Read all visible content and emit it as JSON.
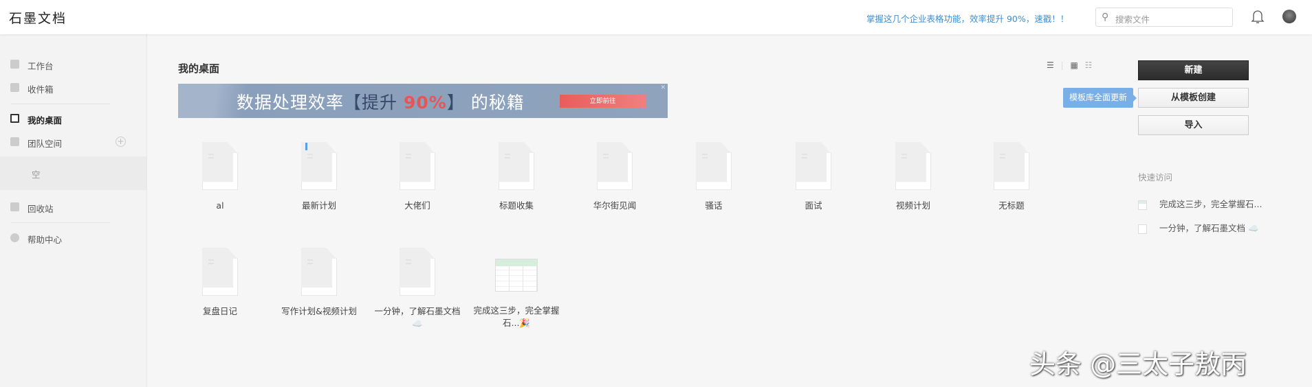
{
  "header": {
    "logo": "石墨文档",
    "tagline": "掌握这几个企业表格功能，效率提升 90%，速戳！！",
    "search_placeholder": "搜索文件"
  },
  "sidebar": {
    "items": [
      {
        "label": "工作台"
      },
      {
        "label": "收件箱"
      },
      {
        "label": "我的桌面"
      },
      {
        "label": "团队空间"
      },
      {
        "label": "回收站"
      },
      {
        "label": "帮助中心"
      }
    ],
    "team_empty": "空"
  },
  "main": {
    "title": "我的桌面",
    "banner": {
      "text_a": "数据处理效率",
      "text_b": "【提升 ",
      "text_c": "90%",
      "text_d": "】",
      "text_e": " 的秘籍",
      "button": "立即前往"
    },
    "files": [
      {
        "name": "al"
      },
      {
        "name": "最新计划"
      },
      {
        "name": "大佬们"
      },
      {
        "name": "标题收集"
      },
      {
        "name": "华尔街见闻"
      },
      {
        "name": "骚话"
      },
      {
        "name": "面试"
      },
      {
        "name": "视频计划"
      },
      {
        "name": "无标题"
      },
      {
        "name": "复盘日记"
      },
      {
        "name": "写作计划&视频计划"
      },
      {
        "name": "一分钟，了解石墨文档☁️"
      },
      {
        "name": "完成这三步，完全掌握石...🎉"
      }
    ]
  },
  "right": {
    "new": "新建",
    "from_template": "从模板创建",
    "import": "导入",
    "tooltip": "模板库全面更新",
    "quick_access_title": "快速访问",
    "quick_access": [
      {
        "label": "完成这三步，完全掌握石..."
      },
      {
        "label": "一分钟，了解石墨文档 ☁️"
      }
    ]
  },
  "watermark": "头条 @三太子敖丙"
}
